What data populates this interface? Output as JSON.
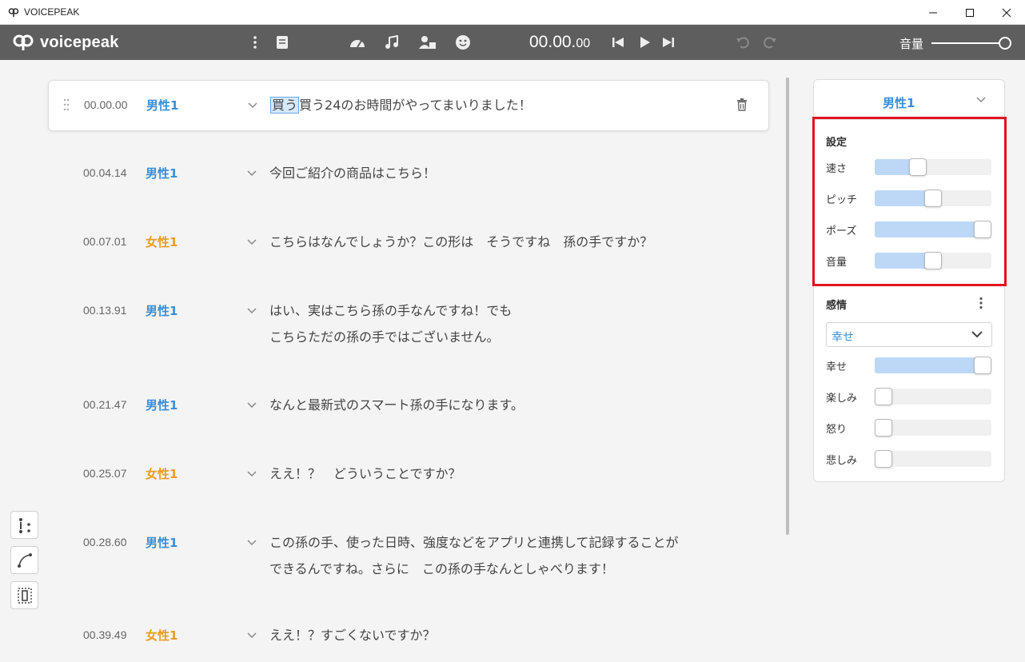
{
  "window": {
    "title": "VOICEPEAK"
  },
  "toolbar": {
    "logo_text": "voicepeak",
    "time_main": "00.00.",
    "time_frac": "00",
    "volume_label": "音量",
    "volume_level": 1.0,
    "icons": [
      "more-vert-icon",
      "dictionary-icon",
      "speedometer-icon",
      "music-note-icon",
      "narrator-icon",
      "smiley-icon",
      "skip-previous-icon",
      "play-icon",
      "skip-next-icon",
      "undo-icon",
      "redo-icon"
    ]
  },
  "rows": [
    {
      "time": "00.00.00",
      "speaker": "男性1",
      "gender": "male",
      "selected_text": "買う",
      "text": "買う24のお時間がやってまいりました！"
    },
    {
      "time": "00.04.14",
      "speaker": "男性1",
      "gender": "male",
      "text": "今回ご紹介の商品はこちら！"
    },
    {
      "time": "00.07.01",
      "speaker": "女性1",
      "gender": "female",
      "text": "こちらはなんでしょうか？この形は　そうですね　孫の手ですか？"
    },
    {
      "time": "00.13.91",
      "speaker": "男性1",
      "gender": "male",
      "text": "はい、実はこちら孫の手なんですね！でも",
      "text2": "こちらただの孫の手ではございません。"
    },
    {
      "time": "00.21.47",
      "speaker": "男性1",
      "gender": "male",
      "text": "なんと最新式のスマート孫の手になります。"
    },
    {
      "time": "00.25.07",
      "speaker": "女性1",
      "gender": "female",
      "text": "ええ！？　どういうことですか？"
    },
    {
      "time": "00.28.60",
      "speaker": "男性1",
      "gender": "male",
      "text": "この孫の手、使った日時、強度などをアプリと連携して記録することが",
      "text2": "できるんですね。さらに　この孫の手なんとしゃべります！"
    },
    {
      "time": "00.39.49",
      "speaker": "女性1",
      "gender": "female",
      "text": "ええ！？すごくないですか？"
    }
  ],
  "panel": {
    "narrator": "男性1",
    "settings_title": "設定",
    "settings": [
      {
        "label": "速さ",
        "level": 0.35
      },
      {
        "label": "ピッチ",
        "level": 0.5
      },
      {
        "label": "ポーズ",
        "level": 1.0
      },
      {
        "label": "音量",
        "level": 0.5
      }
    ],
    "emotion_title": "感情",
    "emotion_selected": "幸せ",
    "emotions": [
      {
        "label": "幸せ",
        "level": 1.0
      },
      {
        "label": "楽しみ",
        "level": 0.0
      },
      {
        "label": "怒り",
        "level": 0.0
      },
      {
        "label": "悲しみ",
        "level": 0.0
      }
    ]
  },
  "colors": {
    "male": "#3a8ed8",
    "female": "#e89d22",
    "toolbar_bg": "#5e5e5e",
    "highlight": "#e0141e",
    "slider_fill": "#bcd8f6"
  }
}
